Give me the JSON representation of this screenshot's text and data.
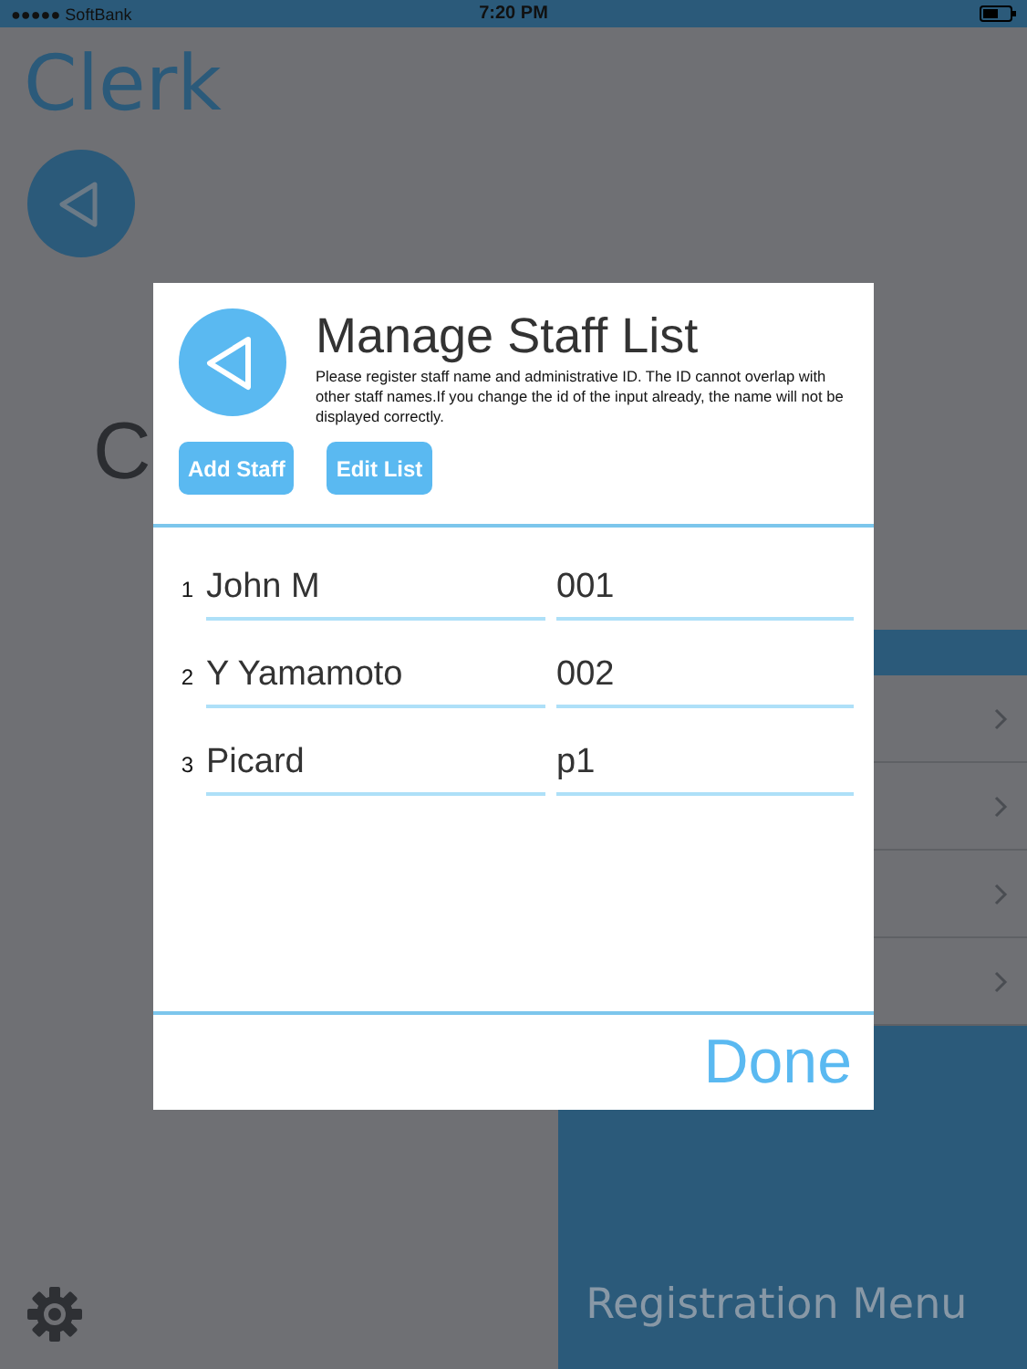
{
  "status_bar": {
    "carrier": "●●●●● SoftBank",
    "time": "7:20 PM"
  },
  "app_title": "Clerk",
  "partial_heading": "C",
  "registration_menu": "Registration Menu",
  "dialog": {
    "title": "Manage Staff List",
    "description": "Please register staff name and administrative ID.  The ID cannot overlap with other staff names.If you change the id of the input already, the name will not be displayed correctly.",
    "buttons": [
      "Add Staff",
      "Edit List"
    ],
    "staff": [
      {
        "number": "1",
        "name": "John M",
        "id": "001"
      },
      {
        "number": "2",
        "name": "Y Yamamoto",
        "id": "002"
      },
      {
        "number": "3",
        "name": "Picard",
        "id": "p1"
      }
    ],
    "done": "Done"
  }
}
